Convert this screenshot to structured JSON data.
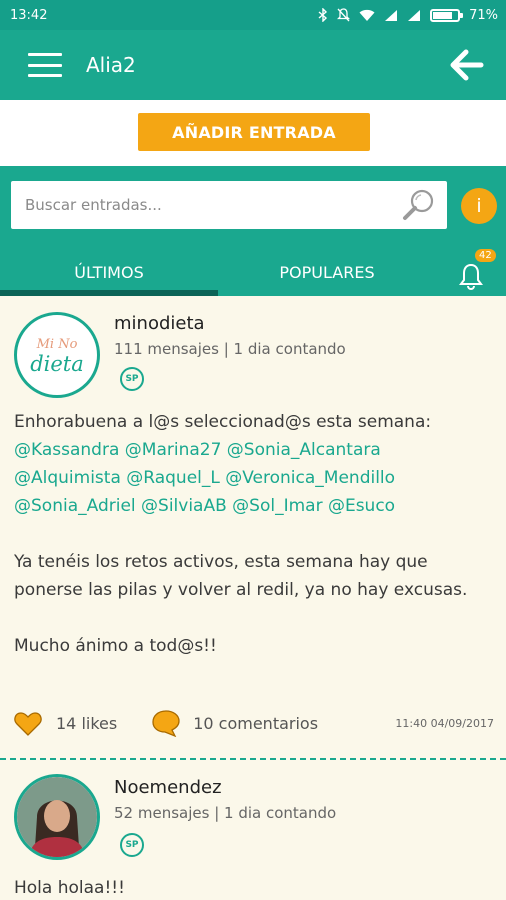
{
  "status_bar": {
    "time": "13:42",
    "battery": "71%",
    "battery_level": 0.71
  },
  "app_bar": {
    "title": "Alia2",
    "menu_icon": "hamburger-menu-icon",
    "back_icon": "arrow-left-icon"
  },
  "actions": {
    "add_entry_label": "AÑADIR ENTRADA"
  },
  "search": {
    "placeholder": "Buscar entradas...",
    "info_label": "i"
  },
  "tabs": [
    {
      "label": "ÚLTIMOS",
      "active": true
    },
    {
      "label": "POPULARES",
      "active": false
    }
  ],
  "notifications": {
    "count": "42"
  },
  "colors": {
    "primary": "#1aa88f",
    "accent": "#f4a614",
    "background": "#fbf8ea"
  },
  "posts": [
    {
      "author": "minodieta",
      "meta": "111 mensajes | 1 dia contando",
      "badge": "SP",
      "avatar_text_top": "Mi No",
      "avatar_text_bottom": "dieta",
      "paragraph_1": "Enhorabuena a l@s seleccionad@s esta semana:",
      "mentions": "@Kassandra @Marina27 @Sonia_Alcantara @Alquimista @Raquel_L @Veronica_Mendillo @Sonia_Adriel @SilviaAB @Sol_Imar @Esuco",
      "paragraph_2": "Ya tenéis los retos activos, esta semana hay que ponerse las pilas y volver al redil, ya no hay excusas.",
      "paragraph_3": "Mucho ánimo a tod@s!!",
      "likes": "14 likes",
      "comments": "10 comentarios",
      "timestamp": "11:40 04/09/2017"
    },
    {
      "author": "Noemendez",
      "meta": "52 mensajes | 1 dia contando",
      "badge": "SP",
      "text": "Hola holaa!!!"
    }
  ]
}
